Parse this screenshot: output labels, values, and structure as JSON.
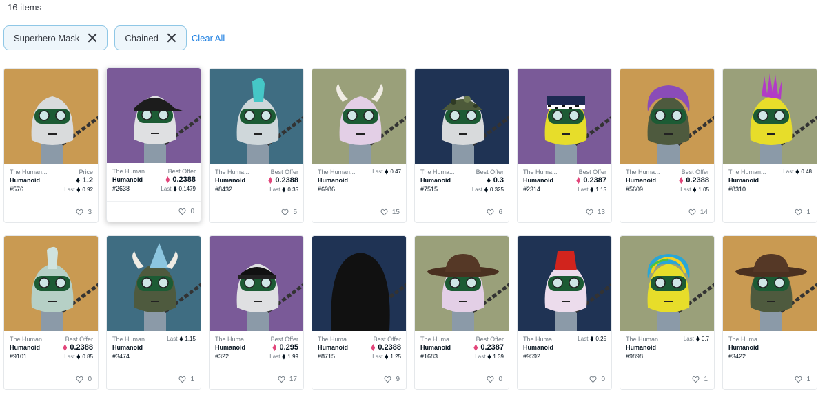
{
  "item_count": "16 items",
  "filters": [
    {
      "label": "Superhero Mask"
    },
    {
      "label": "Chained"
    }
  ],
  "clear_all": "Clear All",
  "cards": [
    {
      "collection": "The Human...",
      "name": "Humanoid",
      "number": "#576",
      "price_label": "Price",
      "price": "1.2",
      "currency": "eth",
      "last_label": "Last",
      "last": "0.92",
      "likes": "3",
      "bg": "#c99a52",
      "skin": "#d9dbdc",
      "hat": "none"
    },
    {
      "collection": "The Human...",
      "name": "Humanoid",
      "number": "#2638",
      "price_label": "Best Offer",
      "price": "0.2388",
      "currency": "weth",
      "last_label": "Last",
      "last": "0.1479",
      "likes": "0",
      "bg": "#7a5a98",
      "skin": "#dfe0e2",
      "hat": "cap"
    },
    {
      "collection": "The Huma...",
      "name": "Humanoid",
      "number": "#8432",
      "price_label": "Best Offer",
      "price": "0.2388",
      "currency": "weth",
      "last_label": "Last",
      "last": "0.35",
      "likes": "5",
      "bg": "#3f6d82",
      "skin": "#cfd7da",
      "hat": "mohawk-cyan"
    },
    {
      "collection": "The Human...",
      "name": "Humanoid",
      "number": "#6986",
      "price_label": "",
      "price": "",
      "currency": "eth",
      "last_label": "Last",
      "last": "0.47",
      "likes": "15",
      "bg": "#9aa07a",
      "skin": "#e3cfe6",
      "hat": "horns"
    },
    {
      "collection": "The Huma...",
      "name": "Humanoid",
      "number": "#7515",
      "price_label": "Best Offer",
      "price": "0.3",
      "currency": "eth",
      "last_label": "Last",
      "last": "0.325",
      "likes": "6",
      "bg": "#1f3354",
      "skin": "#d8dadc",
      "hat": "camo"
    },
    {
      "collection": "The Huma...",
      "name": "Humanoid",
      "number": "#2314",
      "price_label": "Best Offer",
      "price": "0.2387",
      "currency": "weth",
      "last_label": "Last",
      "last": "1.15",
      "likes": "13",
      "bg": "#7a5a98",
      "skin": "#e7dd2a",
      "hat": "police"
    },
    {
      "collection": "The Huma...",
      "name": "Humanoid",
      "number": "#5609",
      "price_label": "Best Offer",
      "price": "0.2388",
      "currency": "weth",
      "last_label": "Last",
      "last": "1.05",
      "likes": "14",
      "bg": "#c99a52",
      "skin": "#4e5a3e",
      "hat": "purple-hair"
    },
    {
      "collection": "The Human...",
      "name": "Humanoid",
      "number": "#8310",
      "price_label": "",
      "price": "",
      "currency": "eth",
      "last_label": "Last",
      "last": "0.48",
      "likes": "1",
      "bg": "#9aa07a",
      "skin": "#e7dd2a",
      "hat": "mohawk-pink"
    },
    {
      "collection": "The Human...",
      "name": "Humanoid",
      "number": "#9101",
      "price_label": "Best Offer",
      "price": "0.2388",
      "currency": "weth",
      "last_label": "Last",
      "last": "0.85",
      "likes": "0",
      "bg": "#c99a52",
      "skin": "#b6d0c6",
      "hat": "mohawk-mint"
    },
    {
      "collection": "The Human...",
      "name": "Humanoid",
      "number": "#3474",
      "price_label": "",
      "price": "",
      "currency": "eth",
      "last_label": "Last",
      "last": "1.15",
      "likes": "1",
      "bg": "#3f6d82",
      "skin": "#4e5a3e",
      "hat": "party"
    },
    {
      "collection": "The Huma...",
      "name": "Humanoid",
      "number": "#322",
      "price_label": "Best Offer",
      "price": "0.295",
      "currency": "weth",
      "last_label": "Last",
      "last": "1.99",
      "likes": "17",
      "bg": "#7a5a98",
      "skin": "#dfe0e2",
      "hat": "cap-back"
    },
    {
      "collection": "The Huma...",
      "name": "Humanoid",
      "number": "#8715",
      "price_label": "Best Offer",
      "price": "0.2388",
      "currency": "weth",
      "last_label": "Last",
      "last": "1.25",
      "likes": "9",
      "bg": "#1f3354",
      "skin": "#cfcfcf",
      "hat": "hood"
    },
    {
      "collection": "The Huma...",
      "name": "Humanoid",
      "number": "#1683",
      "price_label": "Best Offer",
      "price": "0.2387",
      "currency": "weth",
      "last_label": "Last",
      "last": "1.39",
      "likes": "0",
      "bg": "#9aa07a",
      "skin": "#e3cfe6",
      "hat": "cowboy"
    },
    {
      "collection": "The Huma...",
      "name": "Humanoid",
      "number": "#9592",
      "price_label": "",
      "price": "",
      "currency": "eth",
      "last_label": "Last",
      "last": "0.25",
      "likes": "0",
      "bg": "#1f3354",
      "skin": "#ecdcec",
      "hat": "fez"
    },
    {
      "collection": "The Human...",
      "name": "Humanoid",
      "number": "#9898",
      "price_label": "",
      "price": "",
      "currency": "eth",
      "last_label": "Last",
      "last": "0.7",
      "likes": "1",
      "bg": "#9aa07a",
      "skin": "#e7dd2a",
      "hat": "rainbow"
    },
    {
      "collection": "The Huma...",
      "name": "Humanoid",
      "number": "#3422",
      "price_label": "",
      "price": "",
      "currency": "eth",
      "last_label": "",
      "last": "",
      "likes": "1",
      "bg": "#c99a52",
      "skin": "#4e5a3e",
      "hat": "cowboy"
    }
  ]
}
